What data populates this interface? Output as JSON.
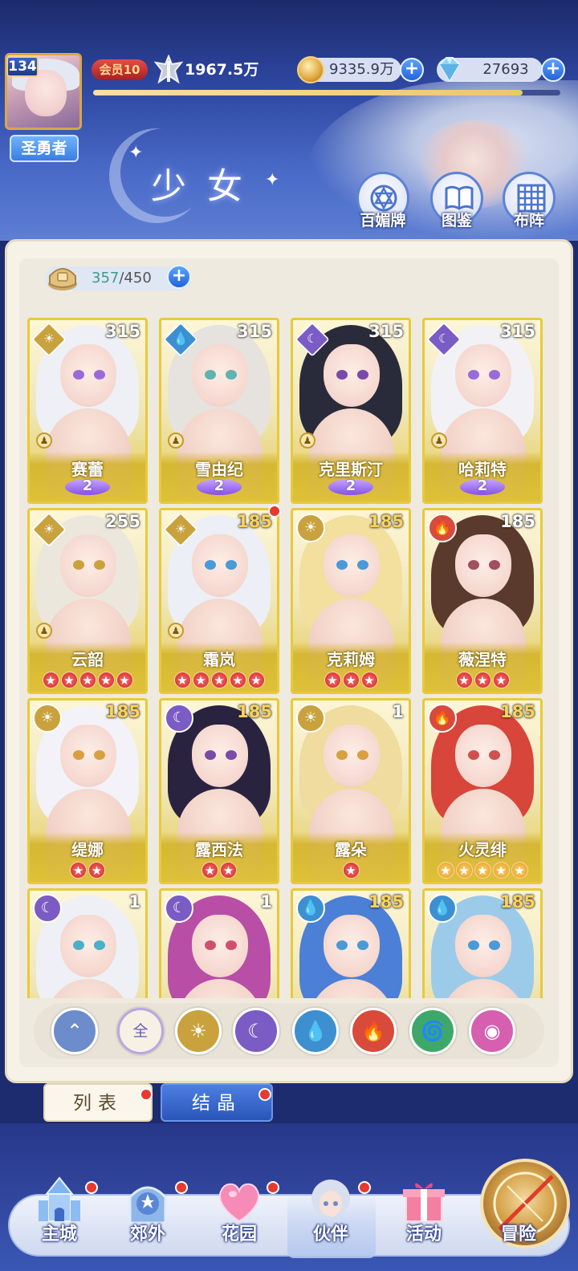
{
  "header": {
    "player_level": "134",
    "player_title": "圣勇者",
    "vip_label": "会员10",
    "power": "1967.5万",
    "gold": "9335.9万",
    "diamonds": "27693",
    "exp_progress": 0.92,
    "page_title": "少女"
  },
  "header_buttons": [
    {
      "label": "百媚牌"
    },
    {
      "label": "图鉴"
    },
    {
      "label": "布阵"
    }
  ],
  "capacity": {
    "current": "357",
    "total": "/450"
  },
  "cards": [
    {
      "name": "赛蕾",
      "level": "315",
      "element": "light",
      "awaken": "2"
    },
    {
      "name": "雪由纪",
      "level": "315",
      "element": "water",
      "awaken": "2"
    },
    {
      "name": "克里斯汀",
      "level": "315",
      "element": "dark",
      "awaken": "2"
    },
    {
      "name": "哈莉特",
      "level": "315",
      "element": "dark",
      "awaken": "2"
    },
    {
      "name": "云韶",
      "level": "255",
      "element": "light",
      "stars": 5
    },
    {
      "name": "霜岚",
      "level": "185",
      "element": "light",
      "stars": 5
    },
    {
      "name": "克莉姆",
      "level": "185",
      "element": "light",
      "stars": 3
    },
    {
      "name": "薇涅特",
      "level": "185",
      "element": "fire",
      "stars": 3
    },
    {
      "name": "缇娜",
      "level": "185",
      "element": "light",
      "stars": 2
    },
    {
      "name": "露西法",
      "level": "185",
      "element": "dark",
      "stars": 2
    },
    {
      "name": "露朵",
      "level": "1",
      "element": "light",
      "stars": 1
    },
    {
      "name": "火灵绯",
      "level": "185",
      "element": "fire",
      "stars": 5
    },
    {
      "name": "",
      "level": "1",
      "element": "dark"
    },
    {
      "name": "",
      "level": "1",
      "element": "dark"
    },
    {
      "name": "",
      "level": "185",
      "element": "water"
    },
    {
      "name": "",
      "level": "185",
      "element": "water"
    }
  ],
  "filters": {
    "all_label": "全"
  },
  "tabs": {
    "list": "列表",
    "crystal": "结晶"
  },
  "nav": {
    "items": [
      {
        "label": "主城"
      },
      {
        "label": "郊外"
      },
      {
        "label": "花园"
      },
      {
        "label": "伙伴"
      },
      {
        "label": "活动"
      },
      {
        "label": "冒险"
      }
    ]
  },
  "colors": {
    "card_gold": "#e8c93a",
    "light": "#c9a23e",
    "water": "#3d8fd0",
    "dark": "#7b5bc4",
    "fire": "#d84a3a",
    "wind": "#3ea86a",
    "spirit": "#d65fb0",
    "all_filter": "#5a7fc8"
  }
}
